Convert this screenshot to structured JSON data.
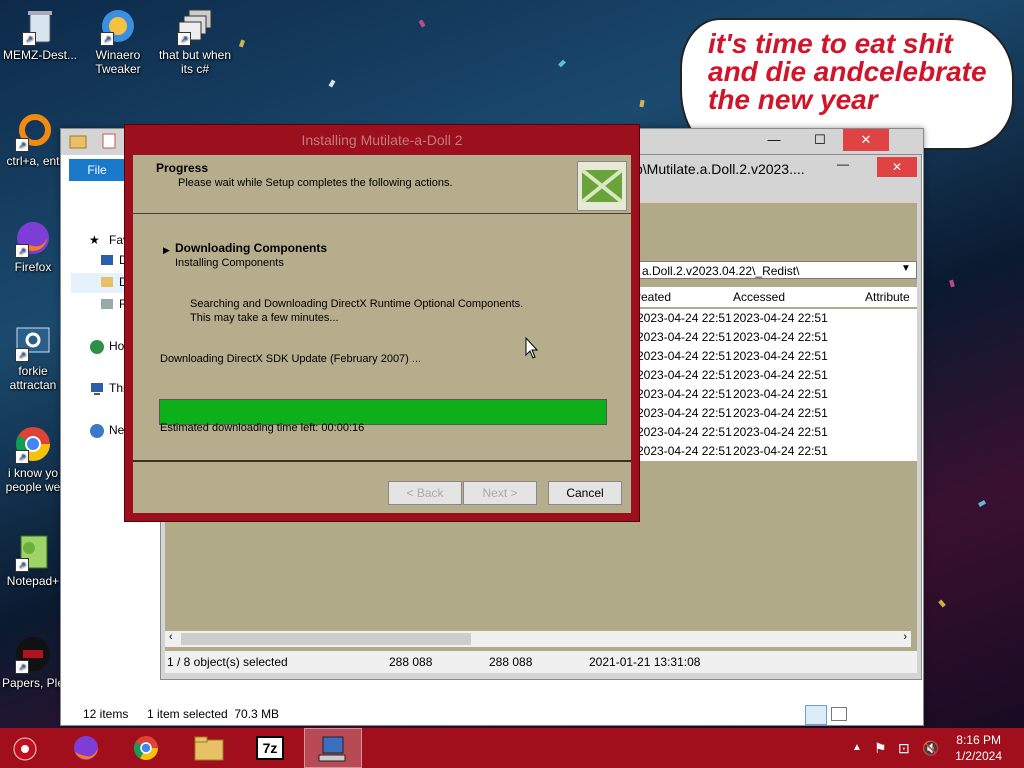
{
  "desktop": {
    "icons": [
      {
        "label": "MEMZ-Dest..."
      },
      {
        "label": "Winaero Tweaker"
      },
      {
        "label": "that but when its c#"
      },
      {
        "label": "ctrl+a, ent"
      },
      {
        "label": "Firefox"
      },
      {
        "label": "forkie attractan"
      },
      {
        "label": "i know yo people we"
      },
      {
        "label": "Notepad+"
      },
      {
        "label": "Papers, Ple"
      }
    ],
    "bubble_text": "it's time to eat shit and die andcelebrate the new year"
  },
  "explorer": {
    "ribbon_file": "File",
    "nav": [
      "Fav",
      "D",
      "D",
      "R",
      "Ho",
      "Thi",
      "Ne"
    ],
    "status_items": "12 items",
    "status_selected": "1 item selected  70.3 MB"
  },
  "archive_window": {
    "title": "p\\Mutilate.a.Doll.2.v2023....",
    "path": "a.Doll.2.v2023.04.22\\_Redist\\",
    "columns": {
      "created": "reated",
      "accessed": "Accessed",
      "attributes": "Attribute"
    },
    "rows": [
      {
        "created": "2023-04-24 22:51",
        "accessed": "2023-04-24 22:51"
      },
      {
        "created": "2023-04-24 22:51",
        "accessed": "2023-04-24 22:51"
      },
      {
        "created": "2023-04-24 22:51",
        "accessed": "2023-04-24 22:51"
      },
      {
        "created": "2023-04-24 22:51",
        "accessed": "2023-04-24 22:51"
      },
      {
        "created": "2023-04-24 22:51",
        "accessed": "2023-04-24 22:51"
      },
      {
        "created": "2023-04-24 22:51",
        "accessed": "2023-04-24 22:51"
      },
      {
        "created": "2023-04-24 22:51",
        "accessed": "2023-04-24 22:51"
      },
      {
        "created": "2023-04-24 22:51",
        "accessed": "2023-04-24 22:51"
      }
    ],
    "status": {
      "selected": "1 / 8 object(s) selected",
      "size": "288 088",
      "packed": "288 088",
      "modified": "2021-01-21 13:31:08"
    }
  },
  "installer": {
    "title": "Installing Mutilate-a-Doll 2",
    "header_title": "Progress",
    "header_subtitle": "Please wait while Setup completes the following actions.",
    "step_title": "Downloading Components",
    "step_subtitle": "Installing Components",
    "detail_line1": "Searching and Downloading DirectX Runtime Optional Components.",
    "detail_line2": "This may take a few minutes...",
    "current_action": "Downloading DirectX SDK Update (February 2007) ...",
    "progress_percent": 100,
    "time_left": "Estimated downloading time left: 00:00:16",
    "buttons": {
      "back": "< Back",
      "next": "Next >",
      "cancel": "Cancel"
    }
  },
  "taskbar": {
    "time": "8:16 PM",
    "date": "1/2/2024",
    "apps": [
      "start-orb",
      "firefox",
      "chrome",
      "file-explorer",
      "7-zip",
      "setup"
    ]
  },
  "colors": {
    "accent_red": "#a10e1c",
    "progress_green": "#0db01b",
    "dialog_body": "#b5ad8b"
  }
}
